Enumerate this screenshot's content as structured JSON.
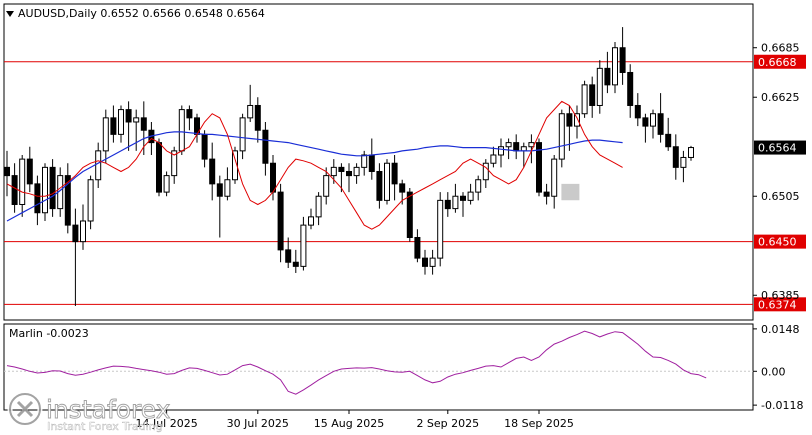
{
  "header": {
    "symbol_line": "AUDUSD,Daily  0.6552 0.6566 0.6548 0.6564"
  },
  "watermark": {
    "brand": "instaforex",
    "tagline": "Instant Forex Trading"
  },
  "colors": {
    "bull_candle": "#ffffff",
    "bear_candle": "#000000",
    "ma_fast": "#e00000",
    "ma_slow": "#1a2ed6",
    "level_line": "#e00000",
    "level_label_bg": "#e00000",
    "current_price_bg": "#000000",
    "oscillator": "#a020a0",
    "highlight": "#bdbdbd"
  },
  "chart_data": [
    {
      "type": "candlestick",
      "title": "AUDUSD,Daily  0.6552 0.6566 0.6548 0.6564",
      "ylim": [
        0.6355,
        0.6738
      ],
      "y_ticks": [
        "0.6685",
        "0.6625",
        "0.6505",
        "0.6385"
      ],
      "x_ticks": [
        {
          "label": "14 Jul 2025",
          "index": 21
        },
        {
          "label": "30 Jul 2025",
          "index": 33
        },
        {
          "label": "15 Aug 2025",
          "index": 45
        },
        {
          "label": "2 Sep 2025",
          "index": 58
        },
        {
          "label": "18 Sep 2025",
          "index": 70
        }
      ],
      "levels": [
        {
          "label": "0.6668",
          "value": 0.6668
        },
        {
          "label": "0.6450",
          "value": 0.645
        },
        {
          "label": "0.6374",
          "value": 0.6374
        }
      ],
      "current_price": {
        "label": "0.6564",
        "value": 0.6564
      },
      "highlight_index": 74,
      "candles": [
        [
          0.654,
          0.653,
          0.656,
          0.6505
        ],
        [
          0.653,
          0.6495,
          0.6545,
          0.6485
        ],
        [
          0.6495,
          0.655,
          0.6555,
          0.648
        ],
        [
          0.655,
          0.652,
          0.6565,
          0.651
        ],
        [
          0.652,
          0.6485,
          0.653,
          0.647
        ],
        [
          0.6485,
          0.654,
          0.6545,
          0.6475
        ],
        [
          0.654,
          0.649,
          0.655,
          0.648
        ],
        [
          0.649,
          0.653,
          0.654,
          0.648
        ],
        [
          0.653,
          0.647,
          0.6545,
          0.646
        ],
        [
          0.647,
          0.645,
          0.649,
          0.6372
        ],
        [
          0.645,
          0.6475,
          0.6495,
          0.644
        ],
        [
          0.6475,
          0.6525,
          0.653,
          0.6465
        ],
        [
          0.6525,
          0.656,
          0.657,
          0.6515
        ],
        [
          0.656,
          0.66,
          0.661,
          0.6545
        ],
        [
          0.66,
          0.658,
          0.6615,
          0.657
        ],
        [
          0.658,
          0.661,
          0.6615,
          0.657
        ],
        [
          0.661,
          0.6595,
          0.662,
          0.656
        ],
        [
          0.6595,
          0.66,
          0.661,
          0.656
        ],
        [
          0.66,
          0.6585,
          0.662,
          0.6555
        ],
        [
          0.6585,
          0.657,
          0.6595,
          0.6555
        ],
        [
          0.657,
          0.651,
          0.6575,
          0.6505
        ],
        [
          0.651,
          0.653,
          0.6535,
          0.6505
        ],
        [
          0.653,
          0.656,
          0.6565,
          0.652
        ],
        [
          0.656,
          0.661,
          0.6615,
          0.6555
        ],
        [
          0.661,
          0.66,
          0.6615,
          0.6585
        ],
        [
          0.66,
          0.658,
          0.6605,
          0.657
        ],
        [
          0.658,
          0.655,
          0.6585,
          0.654
        ],
        [
          0.655,
          0.652,
          0.657,
          0.65
        ],
        [
          0.652,
          0.6505,
          0.653,
          0.6455
        ],
        [
          0.6505,
          0.6525,
          0.654,
          0.65
        ],
        [
          0.6525,
          0.656,
          0.6565,
          0.652
        ],
        [
          0.656,
          0.66,
          0.6605,
          0.655
        ],
        [
          0.66,
          0.6615,
          0.664,
          0.6595
        ],
        [
          0.6615,
          0.6585,
          0.6625,
          0.657
        ],
        [
          0.6585,
          0.6545,
          0.6595,
          0.653
        ],
        [
          0.6545,
          0.651,
          0.6555,
          0.65
        ],
        [
          0.651,
          0.644,
          0.652,
          0.6425
        ],
        [
          0.644,
          0.6425,
          0.6455,
          0.6418
        ],
        [
          0.6425,
          0.642,
          0.644,
          0.6412
        ],
        [
          0.642,
          0.647,
          0.648,
          0.6415
        ],
        [
          0.647,
          0.648,
          0.649,
          0.6465
        ],
        [
          0.648,
          0.6505,
          0.651,
          0.647
        ],
        [
          0.6505,
          0.653,
          0.654,
          0.6495
        ],
        [
          0.653,
          0.654,
          0.655,
          0.652
        ],
        [
          0.654,
          0.6535,
          0.6545,
          0.651
        ],
        [
          0.6535,
          0.653,
          0.6545,
          0.651
        ],
        [
          0.653,
          0.654,
          0.6545,
          0.652
        ],
        [
          0.654,
          0.6555,
          0.656,
          0.653
        ],
        [
          0.6555,
          0.6535,
          0.6575,
          0.6525
        ],
        [
          0.6535,
          0.65,
          0.6545,
          0.649
        ],
        [
          0.65,
          0.6545,
          0.655,
          0.6495
        ],
        [
          0.6545,
          0.652,
          0.6555,
          0.65
        ],
        [
          0.652,
          0.651,
          0.6525,
          0.6495
        ],
        [
          0.651,
          0.6455,
          0.6515,
          0.645
        ],
        [
          0.6455,
          0.643,
          0.6465,
          0.6425
        ],
        [
          0.643,
          0.642,
          0.644,
          0.641
        ],
        [
          0.642,
          0.643,
          0.644,
          0.641
        ],
        [
          0.643,
          0.65,
          0.651,
          0.642
        ],
        [
          0.65,
          0.649,
          0.651,
          0.648
        ],
        [
          0.649,
          0.6505,
          0.652,
          0.6485
        ],
        [
          0.6505,
          0.65,
          0.651,
          0.648
        ],
        [
          0.65,
          0.651,
          0.652,
          0.6495
        ],
        [
          0.651,
          0.6525,
          0.653,
          0.65
        ],
        [
          0.6525,
          0.6545,
          0.655,
          0.6515
        ],
        [
          0.6545,
          0.6555,
          0.6565,
          0.654
        ],
        [
          0.6555,
          0.6565,
          0.6575,
          0.654
        ],
        [
          0.6565,
          0.657,
          0.6575,
          0.655
        ],
        [
          0.657,
          0.656,
          0.658,
          0.655
        ],
        [
          0.656,
          0.6565,
          0.657,
          0.654
        ],
        [
          0.6565,
          0.657,
          0.658,
          0.6545
        ],
        [
          0.657,
          0.651,
          0.6575,
          0.6505
        ],
        [
          0.651,
          0.6505,
          0.652,
          0.6495
        ],
        [
          0.6505,
          0.655,
          0.6555,
          0.649
        ],
        [
          0.655,
          0.6605,
          0.661,
          0.654
        ],
        [
          0.6605,
          0.659,
          0.6615,
          0.656
        ],
        [
          0.659,
          0.6605,
          0.6615,
          0.6575
        ],
        [
          0.6605,
          0.664,
          0.6645,
          0.66
        ],
        [
          0.664,
          0.6615,
          0.665,
          0.66
        ],
        [
          0.6615,
          0.666,
          0.667,
          0.6605
        ],
        [
          0.666,
          0.664,
          0.668,
          0.663
        ],
        [
          0.664,
          0.6685,
          0.6692,
          0.663
        ],
        [
          0.6685,
          0.6655,
          0.671,
          0.664
        ],
        [
          0.6655,
          0.6615,
          0.6665,
          0.66
        ],
        [
          0.6615,
          0.66,
          0.663,
          0.659
        ],
        [
          0.66,
          0.659,
          0.6605,
          0.657
        ],
        [
          0.659,
          0.6605,
          0.661,
          0.6575
        ],
        [
          0.6605,
          0.658,
          0.663,
          0.657
        ],
        [
          0.658,
          0.6565,
          0.66,
          0.656
        ],
        [
          0.6565,
          0.654,
          0.658,
          0.6525
        ],
        [
          0.654,
          0.6552,
          0.656,
          0.6522
        ],
        [
          0.6552,
          0.6564,
          0.6566,
          0.6548
        ]
      ],
      "ma_fast": [
        0.652,
        0.6515,
        0.651,
        0.6508,
        0.6505,
        0.6505,
        0.6508,
        0.6515,
        0.6522,
        0.653,
        0.654,
        0.6545,
        0.6548,
        0.6545,
        0.654,
        0.6535,
        0.654,
        0.655,
        0.6565,
        0.6575,
        0.657,
        0.656,
        0.6555,
        0.656,
        0.6565,
        0.658,
        0.6595,
        0.6605,
        0.66,
        0.658,
        0.655,
        0.652,
        0.65,
        0.6495,
        0.65,
        0.651,
        0.6525,
        0.654,
        0.655,
        0.6548,
        0.6545,
        0.654,
        0.6535,
        0.6525,
        0.6515,
        0.65,
        0.6485,
        0.647,
        0.6465,
        0.647,
        0.648,
        0.649,
        0.65,
        0.6505,
        0.651,
        0.6515,
        0.652,
        0.6525,
        0.653,
        0.6535,
        0.6545,
        0.655,
        0.6545,
        0.654,
        0.653,
        0.6525,
        0.652,
        0.6525,
        0.654,
        0.656,
        0.658,
        0.66,
        0.661,
        0.662,
        0.6615,
        0.66,
        0.658,
        0.6565,
        0.6555,
        0.655,
        0.6545,
        0.654
      ],
      "ma_slow": [
        0.6475,
        0.648,
        0.6485,
        0.649,
        0.6495,
        0.65,
        0.6505,
        0.6512,
        0.652,
        0.6528,
        0.6535,
        0.654,
        0.6545,
        0.655,
        0.6555,
        0.656,
        0.6565,
        0.657,
        0.6575,
        0.6578,
        0.658,
        0.6582,
        0.6583,
        0.6583,
        0.6582,
        0.6581,
        0.658,
        0.658,
        0.6579,
        0.6578,
        0.6577,
        0.6576,
        0.6575,
        0.6574,
        0.6573,
        0.6572,
        0.6571,
        0.657,
        0.6568,
        0.6566,
        0.6564,
        0.6562,
        0.656,
        0.6558,
        0.6556,
        0.6555,
        0.6554,
        0.6554,
        0.6555,
        0.6556,
        0.6557,
        0.6558,
        0.656,
        0.6561,
        0.6562,
        0.6564,
        0.6565,
        0.6566,
        0.6566,
        0.6565,
        0.6564,
        0.6564,
        0.6564,
        0.6564,
        0.6563,
        0.6562,
        0.6561,
        0.656,
        0.656,
        0.656,
        0.6561,
        0.6562,
        0.6564,
        0.6566,
        0.6568,
        0.657,
        0.6572,
        0.6573,
        0.6573,
        0.6572,
        0.6571,
        0.657
      ]
    },
    {
      "type": "line",
      "title": "Marlin -0.0023",
      "ylim": [
        -0.0135,
        0.0165
      ],
      "y_ticks": [
        "0.0148",
        "0.00",
        "-0.0118"
      ],
      "series": [
        {
          "values": [
            0.002,
            0.0015,
            0.0008,
            0.0,
            -0.0006,
            -0.0004,
            0.0002,
            0.0001,
            -0.0008,
            -0.0014,
            -0.001,
            -0.0003,
            0.0005,
            0.0012,
            0.0018,
            0.0017,
            0.0015,
            0.001,
            0.0006,
            0.0002,
            -0.0003,
            -0.001,
            -0.0008,
            0.0003,
            0.0012,
            0.001,
            0.0003,
            -0.0005,
            -0.0013,
            -0.001,
            0.0005,
            0.002,
            0.0025,
            0.0015,
            0.0002,
            -0.001,
            -0.003,
            -0.007,
            -0.008,
            -0.0065,
            -0.0048,
            -0.003,
            -0.0015,
            0.0,
            0.0008,
            0.001,
            0.0012,
            0.0011,
            0.0013,
            0.0008,
            0.0002,
            -0.0002,
            -0.0003,
            0.0,
            -0.0015,
            -0.003,
            -0.004,
            -0.0035,
            -0.002,
            -0.001,
            -0.0005,
            0.0003,
            0.001,
            0.0018,
            0.002,
            0.0015,
            0.003,
            0.0045,
            0.005,
            0.0038,
            0.005,
            0.0075,
            0.0095,
            0.0105,
            0.0118,
            0.0128,
            0.014,
            0.0132,
            0.012,
            0.013,
            0.0138,
            0.0135,
            0.0115,
            0.0095,
            0.007,
            0.005,
            0.0048,
            0.0038,
            0.0025,
            0.0005,
            -0.0008,
            -0.0012,
            -0.0023
          ]
        }
      ]
    }
  ]
}
